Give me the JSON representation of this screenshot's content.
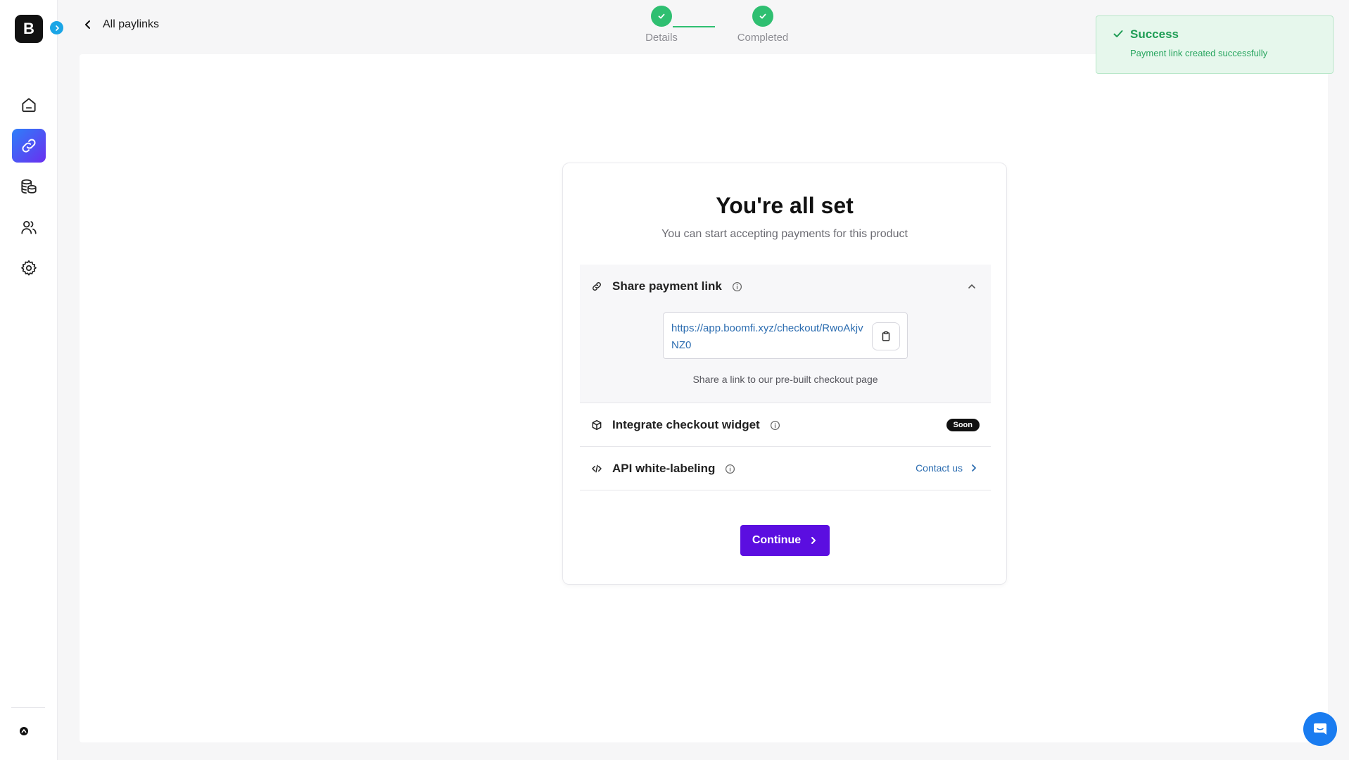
{
  "sidebar": {
    "logo_letter": "B",
    "items": [
      {
        "name": "home",
        "icon": "home-icon"
      },
      {
        "name": "paylinks",
        "icon": "link-icon",
        "active": true
      },
      {
        "name": "transactions",
        "icon": "coins-icon"
      },
      {
        "name": "customers",
        "icon": "users-icon"
      },
      {
        "name": "settings",
        "icon": "gear-icon"
      }
    ]
  },
  "header": {
    "back_label": "All paylinks"
  },
  "stepper": {
    "steps": [
      {
        "label": "Details",
        "status": "done"
      },
      {
        "label": "Completed",
        "status": "done"
      }
    ],
    "color": "#2fbf71"
  },
  "toast": {
    "title": "Success",
    "message": "Payment link created successfully"
  },
  "card": {
    "title": "You're all set",
    "subtitle": "You can start accepting payments for this product",
    "share": {
      "title": "Share payment link",
      "url": "https://app.boomfi.xyz/checkout/RwoAkjvNZ0",
      "caption": "Share a link to our pre-built checkout page"
    },
    "widget": {
      "title": "Integrate checkout widget",
      "badge": "Soon"
    },
    "api": {
      "title": "API white-labeling",
      "link": "Contact us"
    },
    "continue_label": "Continue"
  },
  "colors": {
    "accent": "#5b0ee0",
    "success": "#2fbf71",
    "link": "#2b6cb0"
  }
}
